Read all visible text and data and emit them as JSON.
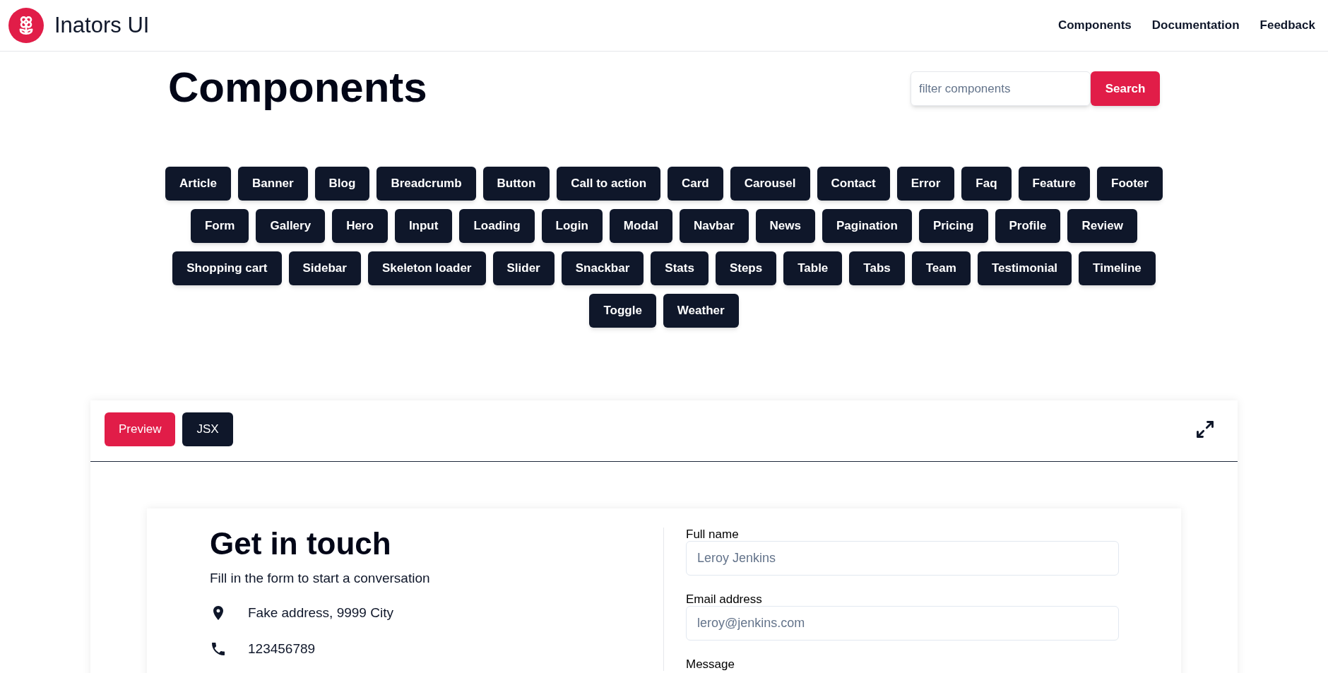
{
  "header": {
    "brand": "Inators UI",
    "nav": [
      "Components",
      "Documentation",
      "Feedback"
    ]
  },
  "page": {
    "title": "Components",
    "search": {
      "placeholder": "filter components",
      "button": "Search"
    }
  },
  "components": [
    "Article",
    "Banner",
    "Blog",
    "Breadcrumb",
    "Button",
    "Call to action",
    "Card",
    "Carousel",
    "Contact",
    "Error",
    "Faq",
    "Feature",
    "Footer",
    "Form",
    "Gallery",
    "Hero",
    "Input",
    "Loading",
    "Login",
    "Modal",
    "Navbar",
    "News",
    "Pagination",
    "Pricing",
    "Profile",
    "Review",
    "Shopping cart",
    "Sidebar",
    "Skeleton loader",
    "Slider",
    "Snackbar",
    "Stats",
    "Steps",
    "Table",
    "Tabs",
    "Team",
    "Testimonial",
    "Timeline",
    "Toggle",
    "Weather"
  ],
  "preview": {
    "tabs": [
      {
        "label": "Preview",
        "selected": true
      },
      {
        "label": "JSX",
        "selected": false
      }
    ],
    "contact": {
      "title": "Get in touch",
      "subtitle": "Fill in the form to start a conversation",
      "details": [
        {
          "kind": "address",
          "text": "Fake address, 9999 City"
        },
        {
          "kind": "phone",
          "text": "123456789"
        }
      ],
      "fields": [
        {
          "label": "Full name",
          "placeholder": "Leroy Jenkins"
        },
        {
          "label": "Email address",
          "placeholder": "leroy@jenkins.com"
        },
        {
          "label": "Message"
        }
      ]
    }
  }
}
